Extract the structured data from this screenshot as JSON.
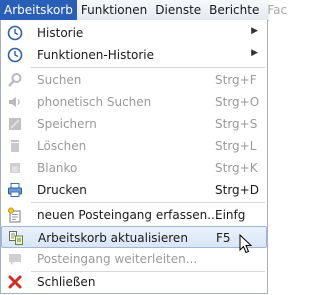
{
  "menubar": {
    "items": [
      {
        "label": "Arbeitskorb"
      },
      {
        "label": "Funktionen"
      },
      {
        "label": "Dienste"
      },
      {
        "label": "Berichte"
      },
      {
        "label": "Fac"
      }
    ]
  },
  "menu": {
    "items": [
      {
        "label": "Historie",
        "icon": "clock-icon",
        "submenu_indicator": "▶"
      },
      {
        "label": "Funktionen-Historie",
        "icon": "clock-icon",
        "submenu_indicator": "▶"
      },
      {
        "label": "Suchen",
        "shortcut": "Strg+F",
        "icon": "search-icon",
        "state": "disabled"
      },
      {
        "label": "phonetisch Suchen",
        "shortcut": "Strg+O",
        "icon": "speaker-icon",
        "state": "disabled"
      },
      {
        "label": "Speichern",
        "shortcut": "Strg+S",
        "icon": "save-icon",
        "state": "disabled"
      },
      {
        "label": "Löschen",
        "shortcut": "Strg+L",
        "icon": "trash-icon",
        "state": "disabled"
      },
      {
        "label": "Blanko",
        "shortcut": "Strg+K",
        "icon": "blank-icon",
        "state": "disabled"
      },
      {
        "label": "Drucken",
        "shortcut": "Strg+D",
        "icon": "printer-icon",
        "state": "enabled"
      },
      {
        "label": "neuen Posteingang erfassen...",
        "shortcut": "Einfg",
        "icon": "new-inbox-icon",
        "state": "enabled"
      },
      {
        "label": "Arbeitskorb aktualisieren",
        "shortcut": "F5",
        "icon": "refresh-icon",
        "state": "highlighted"
      },
      {
        "label": "Posteingang weiterleiten...",
        "icon": "forward-icon",
        "state": "disabled"
      },
      {
        "label": "Schließen",
        "icon": "close-icon",
        "state": "enabled"
      }
    ]
  },
  "colors": {
    "menubar_active_bg": "#2a5fb8",
    "highlight_border": "#9db7dd",
    "disabled_text": "#9a9a9a"
  }
}
